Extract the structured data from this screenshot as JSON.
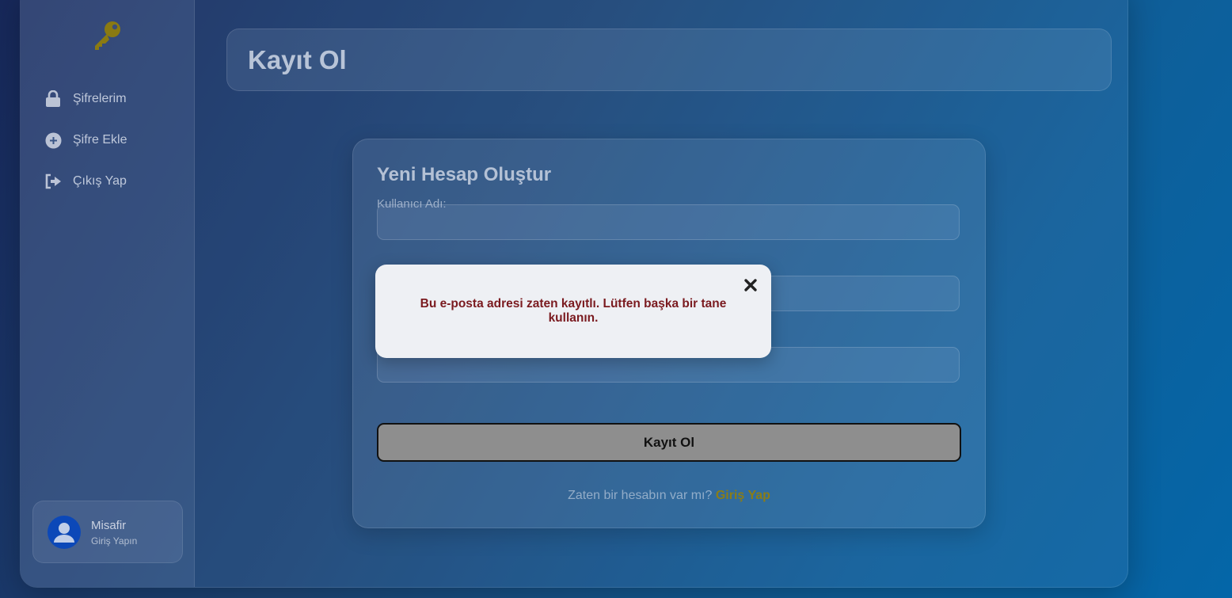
{
  "sidebar": {
    "logo_icon": "key-icon",
    "items": [
      {
        "label": "Şifrelerim",
        "icon": "lock-icon"
      },
      {
        "label": "Şifre Ekle",
        "icon": "plus-circle-icon"
      },
      {
        "label": "Çıkış Yap",
        "icon": "logout-icon"
      }
    ],
    "user": {
      "name": "Misafir",
      "subtitle": "Giriş Yapın",
      "icon": "user-avatar-icon"
    }
  },
  "header": {
    "title": "Kayıt Ol"
  },
  "form": {
    "title": "Yeni Hesap Oluştur",
    "fields": [
      {
        "label": "Kullanıcı Adı:",
        "value": ""
      },
      {
        "label": "",
        "value": ""
      },
      {
        "label": "",
        "value": ""
      }
    ],
    "submit_label": "Kayıt Ol",
    "login_prompt": "Zaten bir hesabın var mı?",
    "login_link": "Giriş Yap"
  },
  "toast": {
    "message": "Bu e-posta adresi zaten kayıtlı. Lütfen başka bir tane kullanın.",
    "close_icon": "close-icon"
  },
  "colors": {
    "accent_gold": "#8a7d18",
    "error_text": "#7a1a1f",
    "avatar_blue": "#0c48b8",
    "button_gray": "#8e8e8e"
  }
}
